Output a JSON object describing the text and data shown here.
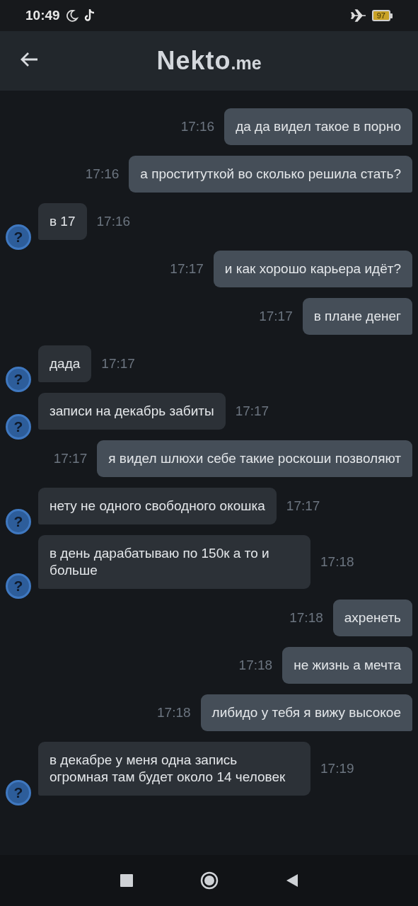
{
  "status_bar": {
    "time": "10:49",
    "battery": "97"
  },
  "header": {
    "logo": "Nekto",
    "logo_suffix": ".me"
  },
  "messages": [
    {
      "kind": "out",
      "text": "да да видел такое в порно",
      "time": "17:16"
    },
    {
      "kind": "out",
      "text": "а проституткой во сколько решила стать?",
      "time": "17:16"
    },
    {
      "kind": "in",
      "avatar": "?",
      "text": "в 17",
      "time": "17:16"
    },
    {
      "kind": "out",
      "text": "и как хорошо карьера идёт?",
      "time": "17:17"
    },
    {
      "kind": "out",
      "text": "в плане денег",
      "time": "17:17"
    },
    {
      "kind": "in",
      "avatar": "?",
      "text": "дада",
      "time": "17:17"
    },
    {
      "kind": "in",
      "avatar": "?",
      "text": "записи на декабрь забиты",
      "time": "17:17"
    },
    {
      "kind": "out",
      "text": "я видел шлюхи себе такие роскоши позволяют",
      "time": "17:17"
    },
    {
      "kind": "in",
      "avatar": "?",
      "text": "нету не одного свободного окошка",
      "time": "17:17"
    },
    {
      "kind": "in",
      "avatar": "?",
      "text": "в день дарабатываю по 150к а то и больше",
      "time": "17:18"
    },
    {
      "kind": "out",
      "text": "ахренеть",
      "time": "17:18"
    },
    {
      "kind": "out",
      "text": "не жизнь а мечта",
      "time": "17:18"
    },
    {
      "kind": "out",
      "text": "либидо у тебя я вижу высокое",
      "time": "17:18"
    },
    {
      "kind": "in",
      "avatar": "?",
      "text": "в декабре у меня одна запись огромная там будет около 14 человек",
      "time": "17:19"
    }
  ]
}
